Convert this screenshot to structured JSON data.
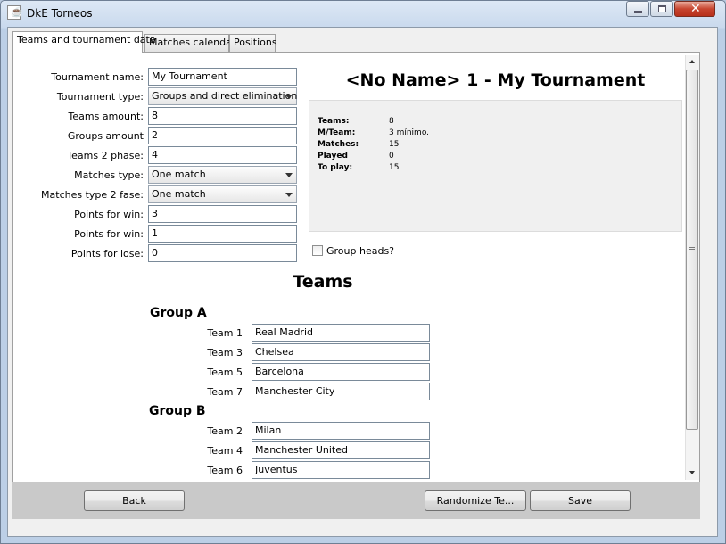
{
  "window": {
    "title": "DkE Torneos",
    "icon": "java-icon"
  },
  "tabs": [
    {
      "label": "Teams and tournament data",
      "active": true
    },
    {
      "label": "Matches calendar",
      "active": false
    },
    {
      "label": "Positions",
      "active": false
    }
  ],
  "form": {
    "tournament_name": {
      "label": "Tournament name:",
      "value": "My Tournament"
    },
    "tournament_type": {
      "label": "Tournament type:",
      "value": "Groups and direct elimination"
    },
    "teams_amount": {
      "label": "Teams amount:",
      "value": "8"
    },
    "groups_amount": {
      "label": "Groups amount",
      "value": "2"
    },
    "teams_2_phase": {
      "label": "Teams 2 phase:",
      "value": "4"
    },
    "matches_type": {
      "label": "Matches type:",
      "value": "One match"
    },
    "matches_type_2": {
      "label": "Matches type 2 fase:",
      "value": "One match"
    },
    "points_win": {
      "label": "Points for win:",
      "value": "3"
    },
    "points_win_2": {
      "label": "Points for win:",
      "value": "1"
    },
    "points_lose": {
      "label": "Points for lose:",
      "value": "0"
    }
  },
  "header_title": "<No Name> 1 - My Tournament",
  "info": [
    {
      "key": "Teams:",
      "value": "8"
    },
    {
      "key": "M/Team:",
      "value": "3 mínimo."
    },
    {
      "key": "Matches:",
      "value": "15"
    },
    {
      "key": "Played",
      "value": "0"
    },
    {
      "key": "To play:",
      "value": "15"
    }
  ],
  "group_heads": {
    "label": "Group heads?",
    "checked": false
  },
  "teams_title": "Teams",
  "groups": [
    {
      "name": "Group A",
      "teams": [
        {
          "label": "Team 1",
          "value": "Real Madrid"
        },
        {
          "label": "Team 3",
          "value": "Chelsea"
        },
        {
          "label": "Team 5",
          "value": "Barcelona"
        },
        {
          "label": "Team 7",
          "value": "Manchester City"
        }
      ]
    },
    {
      "name": "Group B",
      "teams": [
        {
          "label": "Team 2",
          "value": "Milan"
        },
        {
          "label": "Team 4",
          "value": "Manchester United"
        },
        {
          "label": "Team 6",
          "value": "Juventus"
        }
      ]
    }
  ],
  "buttons": {
    "back": "Back",
    "randomize": "Randomize Te...",
    "save": "Save"
  }
}
